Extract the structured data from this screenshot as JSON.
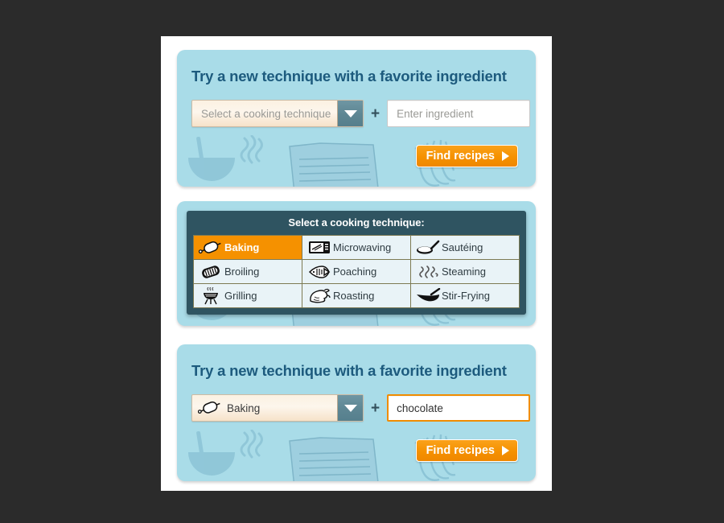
{
  "theme": {
    "page_background": "#2b2b2b",
    "sheet_background": "#ffffff",
    "panel_background": "#a9dce8",
    "title_color": "#1d5b7e",
    "accent_orange": "#f59100",
    "dropdown_background": "#2f5461",
    "cell_background": "#e9f3f7",
    "grid_line_color": "#7d7a53"
  },
  "panel_empty": {
    "title": "Try a new technique with a favorite ingredient",
    "select": {
      "value": "",
      "placeholder": "Select a cooking technique",
      "icon": "none",
      "arrow_icon": "chevron-down-icon"
    },
    "separator": "+",
    "ingredient": {
      "value": "",
      "placeholder": "Enter ingredient",
      "focused": false
    },
    "submit": {
      "label": "Find recipes",
      "icon": "play-triangle-icon"
    }
  },
  "panel_open": {
    "dropdown": {
      "header": "Select a cooking technique:",
      "selected": "Baking",
      "columns": 3,
      "options": [
        {
          "label": "Baking",
          "icon": "rolling-pin-icon",
          "selected": true
        },
        {
          "label": "Microwaving",
          "icon": "microwave-icon",
          "selected": false
        },
        {
          "label": "Sautéing",
          "icon": "saute-pan-icon",
          "selected": false
        },
        {
          "label": "Broiling",
          "icon": "broiler-pan-icon",
          "selected": false
        },
        {
          "label": "Poaching",
          "icon": "fish-icon",
          "selected": false
        },
        {
          "label": "Steaming",
          "icon": "steam-wisps-icon",
          "selected": false
        },
        {
          "label": "Grilling",
          "icon": "grill-icon",
          "selected": false
        },
        {
          "label": "Roasting",
          "icon": "poultry-icon",
          "selected": false
        },
        {
          "label": "Stir-Frying",
          "icon": "wok-icon",
          "selected": false
        }
      ]
    }
  },
  "panel_filled": {
    "title": "Try a new technique with a favorite ingredient",
    "select": {
      "value": "Baking",
      "placeholder": "Select a cooking technique",
      "icon": "rolling-pin-icon",
      "arrow_icon": "chevron-down-icon"
    },
    "separator": "+",
    "ingredient": {
      "value": "chocolate",
      "placeholder": "Enter ingredient",
      "focused": true
    },
    "submit": {
      "label": "Find recipes",
      "icon": "play-triangle-icon"
    }
  },
  "decor": {
    "items": [
      "steaming-bowl-icon",
      "recipe-card-icon",
      "whisk-icon"
    ]
  }
}
